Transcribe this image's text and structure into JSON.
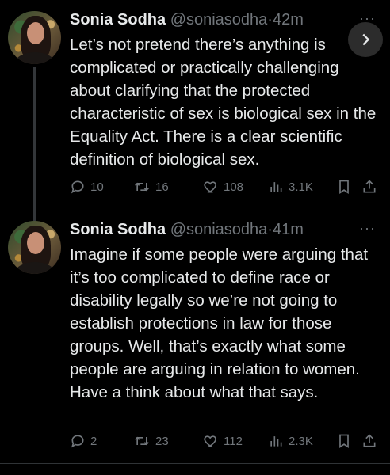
{
  "tweets": [
    {
      "author": "Sonia Sodha",
      "handle": "@soniasodha",
      "separator": "·",
      "time": "42m",
      "more": "···",
      "text": "Let’s not pretend there’s anything is complicated or practically challenging about clarifying that the protected characteristic of sex is biological sex in the Equality Act. There is a clear scientific definition of biological sex.",
      "replies": "10",
      "retweets": "16",
      "likes": "108",
      "views": "3.1K"
    },
    {
      "author": "Sonia Sodha",
      "handle": "@soniasodha",
      "separator": "·",
      "time": "41m",
      "more": "···",
      "text": "Imagine if some people were arguing that it’s too complicated to define race or disability legally so we’re not going to establish protections in law for those groups. Well, that’s exactly what some people are arguing in relation to women. Have a think about what that says.",
      "replies": "2",
      "retweets": "23",
      "likes": "112",
      "views": "2.3K"
    }
  ],
  "icons": {
    "reply": "speech-bubble",
    "retweet": "retweet-arrows",
    "like": "heart",
    "views": "bar-chart",
    "bookmark": "bookmark",
    "share": "share-upload",
    "next": "chevron-right"
  },
  "colors": {
    "background": "#000000",
    "primary_text": "#e7e9ea",
    "secondary_text": "#71767b",
    "thread_line": "#333639"
  }
}
